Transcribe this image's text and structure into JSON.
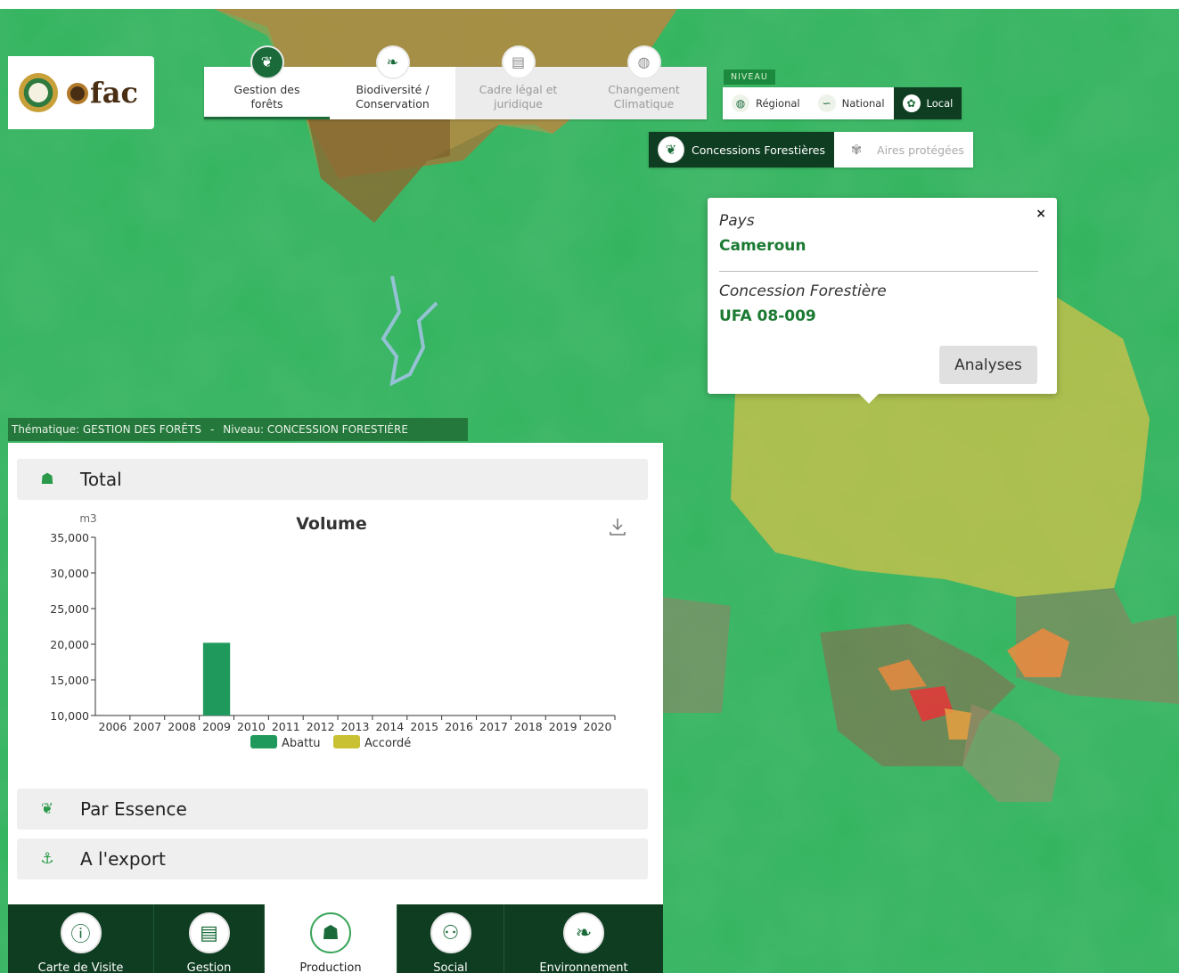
{
  "brand": {
    "name": "fac"
  },
  "theme_tabs": [
    {
      "line1": "Gestion des",
      "line2": "forêts",
      "icon": "tree-icon",
      "state": "active"
    },
    {
      "line1": "Biodiversité /",
      "line2": "Conservation",
      "icon": "leaf-icon",
      "state": "normal"
    },
    {
      "line1": "Cadre légal et",
      "line2": "juridique",
      "icon": "document-icon",
      "state": "dim"
    },
    {
      "line1": "Changement",
      "line2": "Climatique",
      "icon": "globe-icon",
      "state": "dim"
    }
  ],
  "niveau": {
    "tag": "NIVEAU",
    "levels": [
      {
        "label": "Régional",
        "icon": "globe-icon"
      },
      {
        "label": "National",
        "icon": "map-icon"
      },
      {
        "label": "Local",
        "icon": "location-icon",
        "active": true
      }
    ]
  },
  "subtabs": [
    {
      "label": "Concessions Forestières",
      "icon": "tree-icon",
      "active": true
    },
    {
      "label": "Aires protégées",
      "icon": "animal-icon",
      "active": false
    }
  ],
  "popup": {
    "close": "×",
    "field1_label": "Pays",
    "field1_value": "Cameroun",
    "field2_label": "Concession Forestière",
    "field2_value": "UFA 08-009",
    "button": "Analyses"
  },
  "status": {
    "thematique": "Thématique: GESTION DES FORÊTS",
    "separator": "-",
    "niveau": "Niveau: CONCESSION FORESTIÈRE"
  },
  "accordion": {
    "total": "Total",
    "par_essence": "Par Essence",
    "export": "A l'export"
  },
  "chart_data": {
    "type": "bar",
    "title": "Volume",
    "ylabel": "m3",
    "xlabel": "",
    "ylim": [
      10000,
      35000
    ],
    "yticks": [
      "10,000",
      "15,000",
      "20,000",
      "25,000",
      "30,000",
      "35,000"
    ],
    "categories": [
      "2006",
      "2007",
      "2008",
      "2009",
      "2010",
      "2011",
      "2012",
      "2013",
      "2014",
      "2015",
      "2016",
      "2017",
      "2018",
      "2019",
      "2020"
    ],
    "series": [
      {
        "name": "Abattu",
        "color": "#1f9a5c",
        "values": [
          null,
          null,
          null,
          20200,
          null,
          null,
          null,
          null,
          null,
          null,
          null,
          null,
          null,
          null,
          null
        ]
      },
      {
        "name": "Accordé",
        "color": "#c9c132",
        "values": [
          null,
          null,
          null,
          null,
          null,
          null,
          null,
          null,
          null,
          null,
          null,
          null,
          null,
          null,
          null
        ]
      }
    ],
    "legend": "bottom"
  },
  "bottom_nav": [
    {
      "label": "Carte de Visite",
      "icon": "info-icon",
      "active": false
    },
    {
      "label": "Gestion",
      "icon": "document-icon",
      "active": false
    },
    {
      "label": "Production",
      "icon": "logs-icon",
      "active": true
    },
    {
      "label": "Social",
      "icon": "people-icon",
      "active": false
    },
    {
      "label": "Environnement",
      "icon": "leaf-icon",
      "active": false
    }
  ]
}
